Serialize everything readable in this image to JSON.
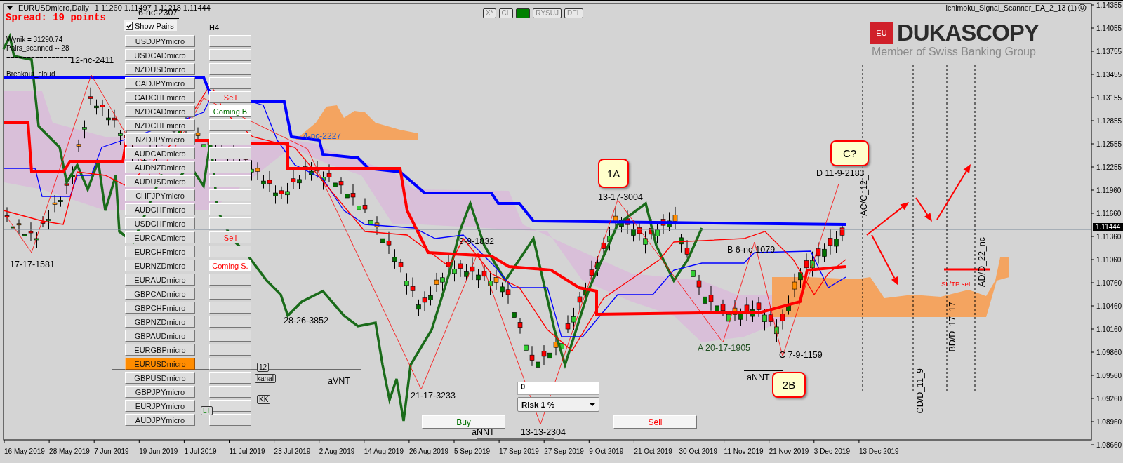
{
  "chart_header": {
    "symbol": "EURUSDmicro,Daily",
    "ohlc": "1.11260 1.11497 1.11218 1.11444"
  },
  "spread": "Spread: 19 points",
  "stats": [
    "Wynik = 31290.74",
    "Pairs_scanned -- 28",
    "================"
  ],
  "strategy_label": "Breakout_cloud",
  "expert_name": "Ichimoku_Signal_Scanner_EA_2_13 (1)",
  "logo": {
    "badge": "EU",
    "brand": "DUKASCOPY",
    "tagline": "Member of Swiss Banking Group"
  },
  "toolbar": [
    {
      "kind": "text",
      "label": "X*"
    },
    {
      "kind": "text",
      "label": "CL"
    },
    {
      "kind": "swatch",
      "color": "#008000"
    },
    {
      "kind": "text",
      "label": "RYSUJ"
    },
    {
      "kind": "text",
      "label": "DEL"
    }
  ],
  "pair_panel": {
    "show_pairs": {
      "label": "Show Pairs",
      "checked": true
    },
    "timeframe": "H4",
    "pairs": [
      {
        "symbol": "USDJPYmicro",
        "selected": false,
        "signal": {
          "kind": "none"
        }
      },
      {
        "symbol": "USDCADmicro",
        "selected": false,
        "signal": {
          "kind": "none"
        }
      },
      {
        "symbol": "NZDUSDmicro",
        "selected": false,
        "signal": {
          "kind": "none"
        }
      },
      {
        "symbol": "CADJPYmicro",
        "selected": false,
        "signal": {
          "kind": "none"
        }
      },
      {
        "symbol": "CADCHFmicro",
        "selected": false,
        "signal": {
          "kind": "sell",
          "label": "Sell"
        }
      },
      {
        "symbol": "NZDCADmicro",
        "selected": false,
        "signal": {
          "kind": "coming_buy",
          "label": "Coming B"
        }
      },
      {
        "symbol": "NZDCHFmicro",
        "selected": false,
        "signal": {
          "kind": "none"
        }
      },
      {
        "symbol": "NZDJPYmicro",
        "selected": false,
        "signal": {
          "kind": "none"
        }
      },
      {
        "symbol": "AUDCADmicro",
        "selected": false,
        "signal": {
          "kind": "none"
        }
      },
      {
        "symbol": "AUDNZDmicro",
        "selected": false,
        "signal": {
          "kind": "none"
        }
      },
      {
        "symbol": "AUDUSDmicro",
        "selected": false,
        "signal": {
          "kind": "none"
        }
      },
      {
        "symbol": "CHFJPYmicro",
        "selected": false,
        "signal": {
          "kind": "none"
        }
      },
      {
        "symbol": "AUDCHFmicro",
        "selected": false,
        "signal": {
          "kind": "none"
        }
      },
      {
        "symbol": "USDCHFmicro",
        "selected": false,
        "signal": {
          "kind": "none"
        }
      },
      {
        "symbol": "EURCADmicro",
        "selected": false,
        "signal": {
          "kind": "sell",
          "label": "Sell"
        }
      },
      {
        "symbol": "EURCHFmicro",
        "selected": false,
        "signal": {
          "kind": "none"
        }
      },
      {
        "symbol": "EURNZDmicro",
        "selected": false,
        "signal": {
          "kind": "coming_sell",
          "label": "Coming S."
        }
      },
      {
        "symbol": "EURAUDmicro",
        "selected": false,
        "signal": {
          "kind": "none"
        }
      },
      {
        "symbol": "GBPCADmicro",
        "selected": false,
        "signal": {
          "kind": "none"
        }
      },
      {
        "symbol": "GBPCHFmicro",
        "selected": false,
        "signal": {
          "kind": "none"
        }
      },
      {
        "symbol": "GBPNZDmicro",
        "selected": false,
        "signal": {
          "kind": "none"
        }
      },
      {
        "symbol": "GBPAUDmicro",
        "selected": false,
        "signal": {
          "kind": "none"
        }
      },
      {
        "symbol": "EURGBPmicro",
        "selected": false,
        "signal": {
          "kind": "none"
        }
      },
      {
        "symbol": "EURUSDmicro",
        "selected": true,
        "signal": {
          "kind": "none"
        }
      },
      {
        "symbol": "GBPUSDmicro",
        "selected": false,
        "signal": {
          "kind": "none"
        }
      },
      {
        "symbol": "GBPJPYmicro",
        "selected": false,
        "signal": {
          "kind": "none"
        }
      },
      {
        "symbol": "EURJPYmicro",
        "selected": false,
        "signal": {
          "kind": "none"
        }
      },
      {
        "symbol": "AUDJPYmicro",
        "selected": false,
        "signal": {
          "kind": "none"
        }
      }
    ]
  },
  "mini_buttons": [
    {
      "label": "12",
      "kind": "plain"
    },
    {
      "label": "kanal",
      "kind": "plain"
    },
    {
      "label": "KK",
      "kind": "plain"
    },
    {
      "label": "LT",
      "kind": "green"
    }
  ],
  "annotations": [
    {
      "text": "6-nc-2307",
      "kind": "label"
    },
    {
      "text": "12-nc-2411",
      "kind": "label"
    },
    {
      "text": "4-nc-2227",
      "kind": "cloud_label"
    },
    {
      "text": "17-17-1581",
      "kind": "label"
    },
    {
      "text": "28-26-3852",
      "kind": "label"
    },
    {
      "text": "9-9-1832",
      "kind": "label"
    },
    {
      "text": "aVNT",
      "kind": "label"
    },
    {
      "text": "21-17-3233",
      "kind": "label"
    },
    {
      "text": "aNNT",
      "kind": "label"
    },
    {
      "text": "13-13-2304",
      "kind": "label"
    },
    {
      "text": "13-17-3004",
      "kind": "label"
    },
    {
      "text": "B 6-nc-1079",
      "kind": "label"
    },
    {
      "text": "A 20-17-1905",
      "kind": "wave_label"
    },
    {
      "text": "C 7-9-1159",
      "kind": "label"
    },
    {
      "text": "aNNT",
      "kind": "label"
    },
    {
      "text": "D 11-9-2183",
      "kind": "label"
    },
    {
      "text": "AC/C_12_",
      "kind": "vertical"
    },
    {
      "text": "CD/D_11_9",
      "kind": "vertical"
    },
    {
      "text": "BD/D_17_17",
      "kind": "vertical"
    },
    {
      "text": "AD/D_22_nc",
      "kind": "vertical"
    },
    {
      "text": "SL/TP set",
      "kind": "alert"
    }
  ],
  "callouts": [
    "1A",
    "C?",
    "2B"
  ],
  "trade_panel": {
    "lots": "0",
    "risk": "Risk  1 %",
    "buy": "Buy",
    "sell": "Sell"
  },
  "price_axis": [
    "1.14355",
    "1.14055",
    "1.13755",
    "1.13455",
    "1.13155",
    "1.12855",
    "1.12555",
    "1.12255",
    "1.11960",
    "1.11660",
    "1.11360",
    "1.11060",
    "1.10760",
    "1.10460",
    "1.10160",
    "1.09860",
    "1.09560",
    "1.09260",
    "1.08960",
    "1.08660"
  ],
  "current_price": "1.11444",
  "date_axis": [
    "16 May 2019",
    "28 May 2019",
    "7 Jun 2019",
    "19 Jun 2019",
    "1 Jul 2019",
    "11 Jul 2019",
    "23 Jul 2019",
    "2 Aug 2019",
    "14 Aug 2019",
    "26 Aug 2019",
    "5 Sep 2019",
    "17 Sep 2019",
    "27 Sep 2019",
    "9 Oct 2019",
    "21 Oct 2019",
    "30 Oct 2019",
    "11 Nov 2019",
    "21 Nov 2019",
    "3 Dec 2019",
    "13 Dec 2019"
  ]
}
